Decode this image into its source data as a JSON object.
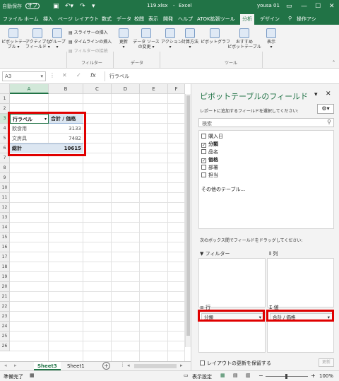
{
  "titlebar": {
    "autosave": "自動保存",
    "autosave_state": "オフ",
    "filename": "119.xlsx",
    "app": "Excel",
    "user": "yousa 01"
  },
  "tabs": [
    "ファイル",
    "ホーム",
    "挿入",
    "ページ レイアウト",
    "数式",
    "データ",
    "校閲",
    "表示",
    "開発",
    "ヘルプ",
    "ATOK拡張ツール",
    "分析",
    "デザイン"
  ],
  "active_tab": "分析",
  "tell_me": "操作アシ",
  "ribbon": {
    "pivot_table": "ピボットテー\nブル ▾",
    "active_field": "アクティブな\nフィールド ▾",
    "group": "グループ\n▾",
    "insert_slicer": "スライサーの挿入",
    "insert_timeline": "タイムラインの挿入",
    "filter_connections": "フィルターの接続",
    "filter_group": "フィルター",
    "refresh": "更新\n▾",
    "change_source": "データ ソース\nの変更 ▾",
    "data_group": "データ",
    "actions": "アクション\n▾",
    "calculations": "計算方法\n▾",
    "pivot_chart": "ピボットグラフ",
    "recommended": "おすすめ\nピボットテーブル",
    "tools_group": "ツール",
    "show": "表示\n▾"
  },
  "formula_bar": {
    "namebox": "A3",
    "cancel": "✕",
    "enter": "✓",
    "fx": "fx",
    "content": "行ラベル"
  },
  "columns": [
    "A",
    "B",
    "C",
    "D",
    "E",
    "F"
  ],
  "rows": [
    "1",
    "2",
    "3",
    "4",
    "5",
    "6",
    "7",
    "8",
    "9",
    "10",
    "11",
    "12",
    "13",
    "14",
    "15",
    "16",
    "17",
    "18",
    "19",
    "20",
    "21",
    "22",
    "23",
    "24",
    "25",
    "26"
  ],
  "pivot": {
    "header_row_label": "行ラベル",
    "header_value": "合計 / 価格",
    "rows": [
      {
        "label": "飲食用",
        "value": "3133"
      },
      {
        "label": "文房具",
        "value": "7482"
      }
    ],
    "total_label": "総計",
    "total_value": "10615"
  },
  "sheets": [
    "Sheet3",
    "Sheet1"
  ],
  "active_sheet": "Sheet3",
  "status": {
    "ready": "準備完了",
    "display_settings": "表示設定",
    "zoom": "100%"
  },
  "pane": {
    "title": "ピボットテーブルのフィールド",
    "subtitle": "レポートに追加するフィールドを選択してください:",
    "search_placeholder": "検索",
    "fields": [
      {
        "name": "購入日",
        "checked": false,
        "bold": false
      },
      {
        "name": "分類",
        "checked": true,
        "bold": true
      },
      {
        "name": "品名",
        "checked": false,
        "bold": false
      },
      {
        "name": "価格",
        "checked": true,
        "bold": true
      },
      {
        "name": "部署",
        "checked": false,
        "bold": false
      },
      {
        "name": "担当",
        "checked": false,
        "bold": false
      }
    ],
    "other_tables": "その他のテーブル...",
    "drag_hint": "次のボックス間でフィールドをドラッグしてください:",
    "filter_label": "フィルター",
    "columns_label": "列",
    "rows_label": "行",
    "values_label": "値",
    "rows_item": "分類",
    "values_item": "合計 / 価格",
    "defer_label": "レイアウトの更新を保留する",
    "update_button": "更新"
  },
  "colors": {
    "excel_green": "#217346",
    "highlight_red": "#e00000",
    "pivot_header_fill": "#dce6f1"
  }
}
